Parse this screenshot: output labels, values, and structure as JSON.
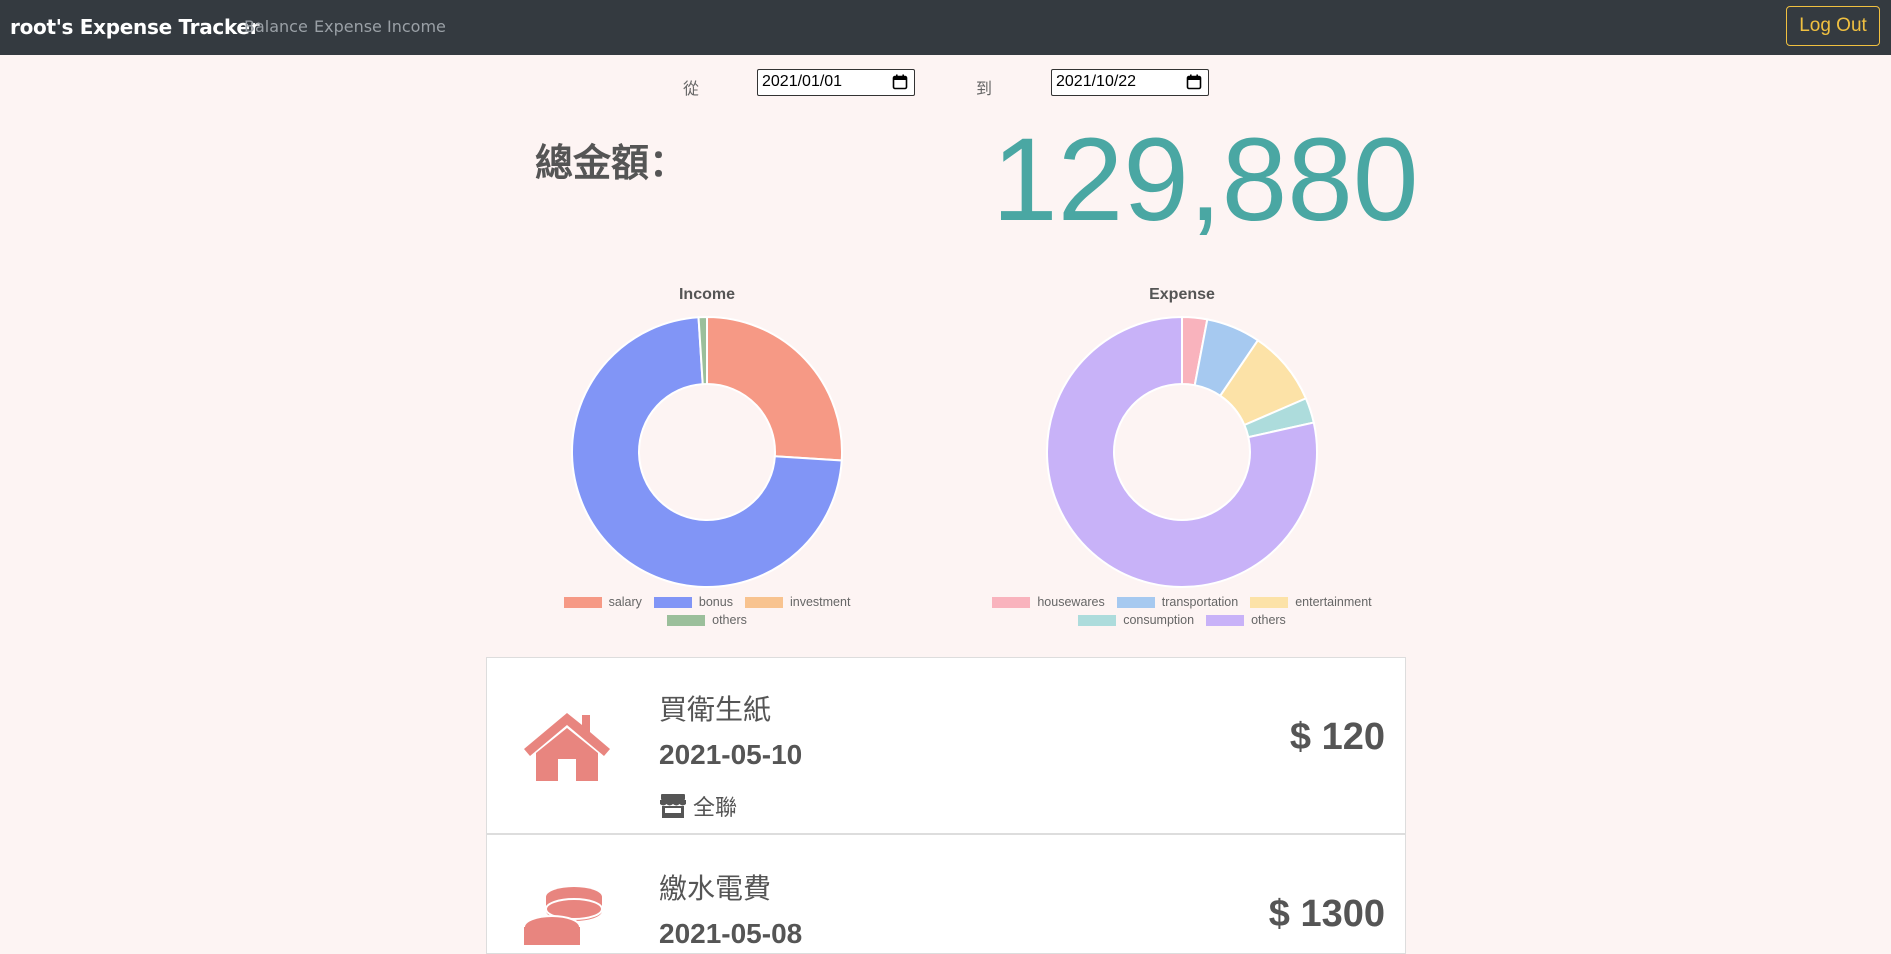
{
  "navbar": {
    "brand": "root's Expense Tracker",
    "links": [
      "Balance",
      "Expense",
      "Income"
    ],
    "logout_label": "Log Out"
  },
  "filter": {
    "from_label": "從",
    "from_value": "2021/01/01",
    "to_label": "到",
    "to_value": "2021/10/22"
  },
  "total": {
    "label": "總金額：",
    "amount": "129,880"
  },
  "colors": {
    "accent": "#4aa7a3",
    "navbar": "#343a40",
    "logout": "#f0c040",
    "icon": "#e8857f"
  },
  "chart_data": [
    {
      "type": "pie",
      "title": "Income",
      "donut": true,
      "categories": [
        "salary",
        "bonus",
        "investment",
        "others"
      ],
      "values": [
        26,
        73,
        0,
        1
      ],
      "colors": [
        "#f69985",
        "#8195f6",
        "#f8c38f",
        "#9bbf9b"
      ],
      "legend": "bottom"
    },
    {
      "type": "pie",
      "title": "Expense",
      "donut": true,
      "categories": [
        "housewares",
        "transportation",
        "entertainment",
        "consumption",
        "others"
      ],
      "values": [
        3,
        6.5,
        9,
        3,
        78.5
      ],
      "colors": [
        "#f9b3bd",
        "#a6c9f0",
        "#fce2a7",
        "#addcdc",
        "#c8b2f8"
      ],
      "legend": "bottom"
    }
  ],
  "records": [
    {
      "icon": "house-icon",
      "title": "買衛生紙",
      "date": "2021-05-10",
      "store_icon": "store-icon",
      "store": "全聯",
      "amount": "$ 120"
    },
    {
      "icon": "coins-icon",
      "title": "繳水電費",
      "date": "2021-05-08",
      "amount": "$ 1300"
    }
  ]
}
